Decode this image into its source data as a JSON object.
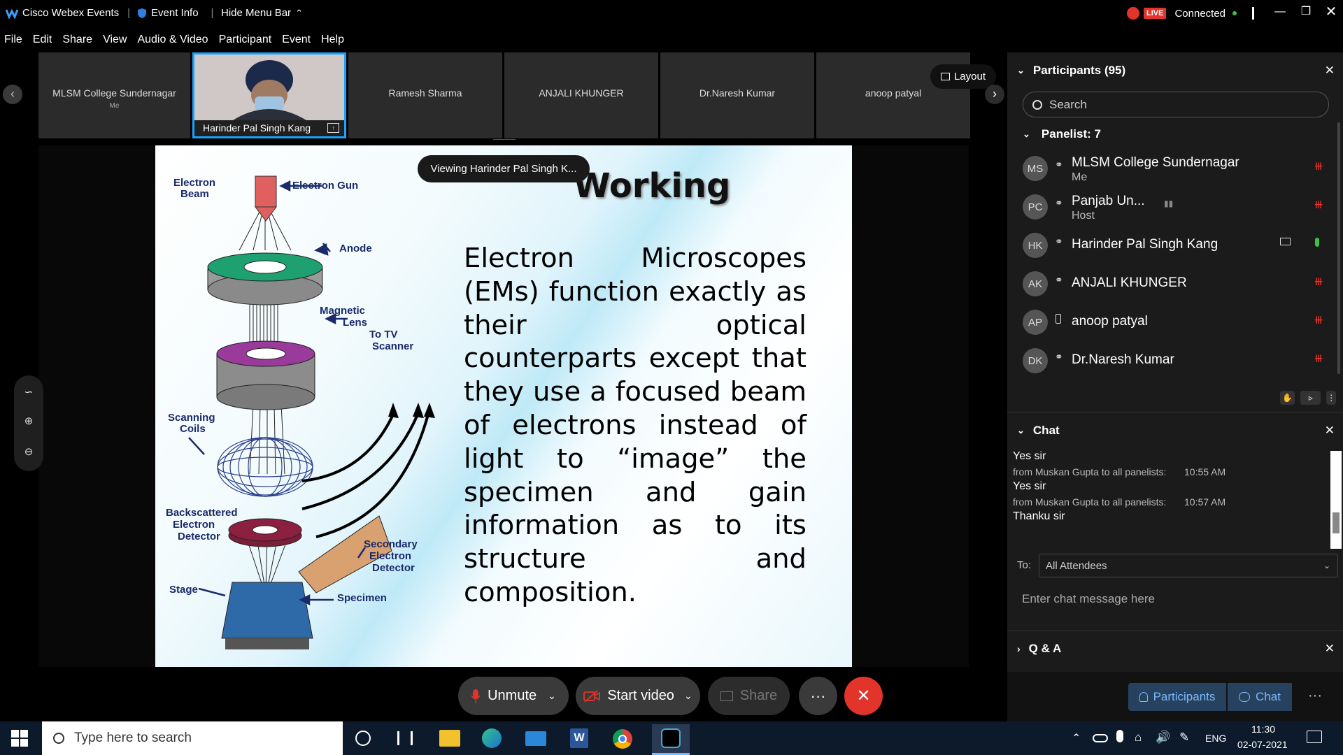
{
  "titlebar": {
    "app": "Cisco Webex Events",
    "event_info": "Event Info",
    "hide_menu": "Hide Menu Bar",
    "live": "LIVE",
    "status": "Connected"
  },
  "menu": [
    "File",
    "Edit",
    "Share",
    "View",
    "Audio & Video",
    "Participant",
    "Event",
    "Help"
  ],
  "strip": {
    "tiles": [
      {
        "name": "MLSM College Sundernagar",
        "sub": "Me"
      },
      {
        "name": "Harinder Pal Singh Kang"
      },
      {
        "name": "Ramesh Sharma"
      },
      {
        "name": "ANJALI KHUNGER"
      },
      {
        "name": "Dr.Naresh Kumar"
      },
      {
        "name": "anoop patyal"
      }
    ],
    "layout_label": "Layout"
  },
  "share": {
    "viewing": "Viewing Harinder Pal Singh K..."
  },
  "slide": {
    "title": "Working",
    "body": "Electron Microscopes (EMs) function exactly as their optical counterparts except that they use a focused beam of electrons instead of light to “image” the specimen and gain information as to its structure and composition.",
    "labels": {
      "electron_beam": "Electron Beam",
      "electron_gun": "Electron Gun",
      "anode": "Anode",
      "magnetic_lens": "Magnetic Lens",
      "tv_scanner": "To TV Scanner",
      "scanning_coils": "Scanning Coils",
      "backscattered": "Backscattered Electron Detector",
      "secondary": "Secondary Electron Detector",
      "stage": "Stage",
      "specimen": "Specimen"
    }
  },
  "controls": {
    "unmute": "Unmute",
    "start_video": "Start video",
    "share": "Share"
  },
  "panel": {
    "participants_title": "Participants (95)",
    "search_placeholder": "Search",
    "panelist_header": "Panelist: 7",
    "participants": [
      {
        "initials": "MS",
        "name": "MLSM College Sundernagar",
        "role": "Me"
      },
      {
        "initials": "PC",
        "name": "Panjab Un...",
        "role": "Host"
      },
      {
        "initials": "HK",
        "name": "Harinder Pal Singh Kang",
        "role": ""
      },
      {
        "initials": "AK",
        "name": "ANJALI KHUNGER",
        "role": ""
      },
      {
        "initials": "AP",
        "name": "anoop patyal",
        "role": ""
      },
      {
        "initials": "DK",
        "name": "Dr.Naresh Kumar",
        "role": ""
      }
    ],
    "chat_title": "Chat",
    "chat": [
      {
        "text": "Yes sir",
        "meta": "from Muskan Gupta to all panelists:",
        "time": "10:55 AM"
      },
      {
        "text": "Yes sir",
        "meta": "from Muskan Gupta to all panelists:",
        "time": "10:57 AM"
      },
      {
        "text": "Thanku sir"
      }
    ],
    "to_label": "To:",
    "to_value": "All Attendees",
    "chat_placeholder": "Enter chat message here",
    "qa_title": "Q & A",
    "bottom_participants": "Participants",
    "bottom_chat": "Chat"
  },
  "taskbar": {
    "search_placeholder": "Type here to search",
    "lang": "ENG",
    "time": "11:30",
    "date": "02-07-2021"
  }
}
